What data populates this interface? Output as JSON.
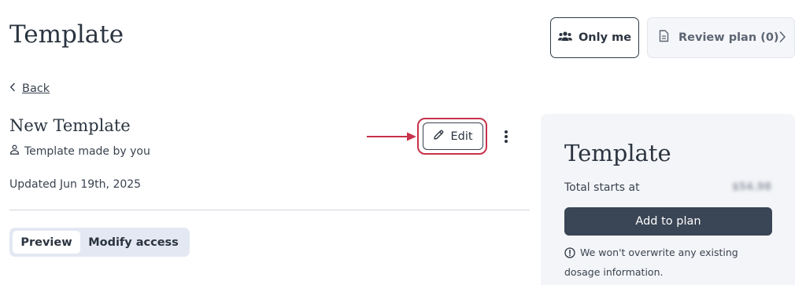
{
  "header": {
    "title": "Template",
    "only_me_label": "Only me",
    "review_plan_label": "Review plan (0)"
  },
  "nav": {
    "back_label": "Back"
  },
  "template": {
    "name": "New Template",
    "made_by": "Template made by you",
    "updated": "Updated Jun 19th, 2025",
    "edit_label": "Edit"
  },
  "tabs": [
    {
      "label": "Preview",
      "active": true
    },
    {
      "label": "Modify access",
      "active": false
    }
  ],
  "panel": {
    "title": "Template",
    "total_label": "Total starts at",
    "total_price": "$54.98",
    "add_button_label": "Add to plan",
    "note": "We won't overwrite any existing dosage information."
  },
  "colors": {
    "highlight": "#c8324b",
    "primary": "#3a4555"
  },
  "icons": [
    "people-icon",
    "document-icon",
    "chevron-right-icon",
    "chevron-left-icon",
    "person-icon",
    "pencil-icon",
    "more-vertical-icon",
    "info-icon",
    "arrow-right-icon"
  ]
}
